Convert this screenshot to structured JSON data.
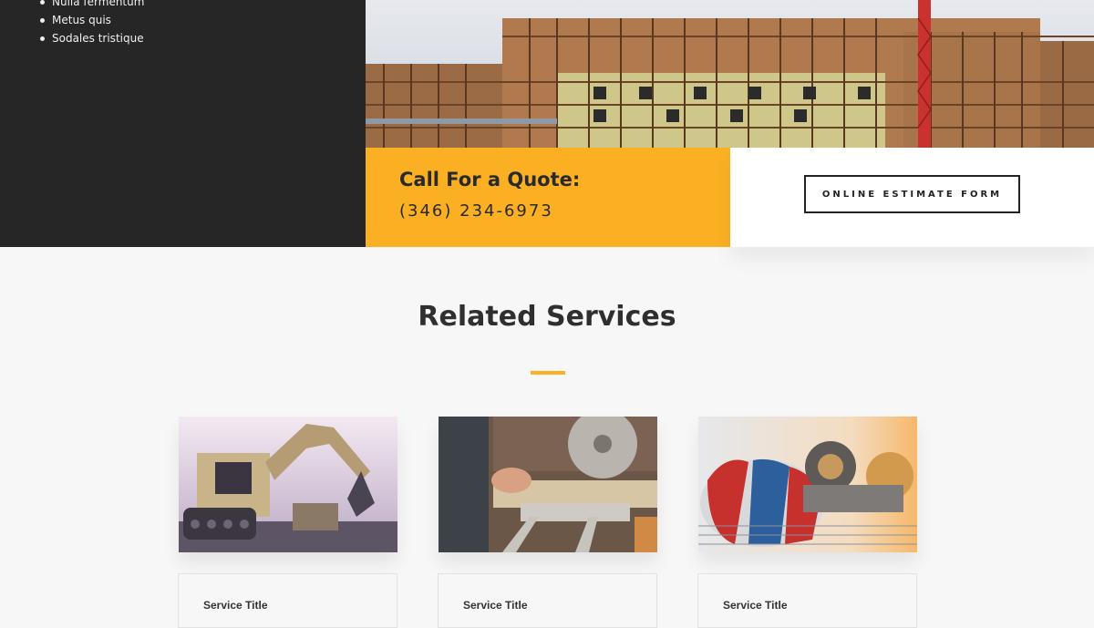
{
  "sidebar": {
    "bullets": [
      "Nulla fermentum",
      "Metus quis",
      "Sodales tristique"
    ]
  },
  "quote": {
    "title": "Call For a Quote:",
    "phone": "(346) 234-6973"
  },
  "estimate": {
    "button_label": "ONLINE ESTIMATE FORM"
  },
  "services": {
    "heading": "Related Services",
    "cards": [
      {
        "title": "Service Title",
        "image": "excavator-photo"
      },
      {
        "title": "Service Title",
        "image": "saw-photo"
      },
      {
        "title": "Service Title",
        "image": "cement-mixer-photo"
      }
    ]
  },
  "colors": {
    "accent": "#fbb023",
    "dark": "#262626",
    "background": "#f7f7f7"
  }
}
